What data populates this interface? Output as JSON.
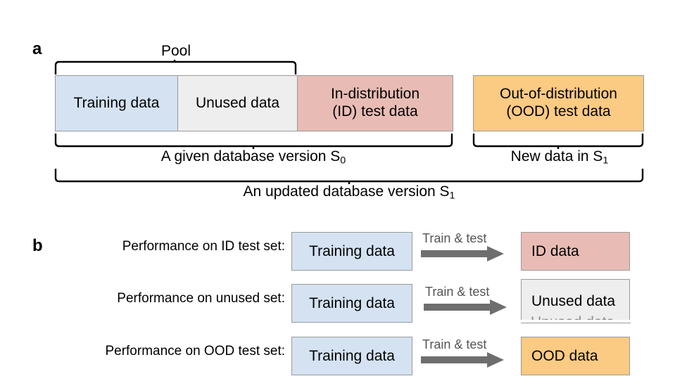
{
  "figure": {
    "panel_a": {
      "letter": "a",
      "pool_label": "Pool",
      "segments": [
        {
          "label": "Training data",
          "color": "#d4e2f2",
          "name": "training-data"
        },
        {
          "label": "Unused data",
          "color": "#eeeeee",
          "name": "unused-data"
        },
        {
          "label_line1": "In-distribution",
          "label_line2": "(ID) test data",
          "color": "#e8bcb4",
          "name": "id-test-data"
        }
      ],
      "ood_segment": {
        "label_line1": "Out-of-distribution",
        "label_line2": "(OOD) test data",
        "color": "#fbca83",
        "name": "ood-test-data"
      },
      "brackets": [
        {
          "text_prefix": "A given database version S",
          "subscript": "0",
          "name": "given-database-version"
        },
        {
          "text_prefix": "New data in S",
          "subscript": "1",
          "name": "new-data"
        },
        {
          "text_prefix": "An updated database version S",
          "subscript": "1",
          "name": "updated-database-version"
        }
      ]
    },
    "panel_b": {
      "letter": "b",
      "arrow_label": "Train & test",
      "rows": [
        {
          "label": "Performance on ID test set:",
          "source": "Training data",
          "target": "ID data",
          "target_color": "#e8bcb4",
          "name": "row-id"
        },
        {
          "label": "Performance on unused set:",
          "source": "Training data",
          "target": "Unused data",
          "target_color": "#eeeeee",
          "ghost": "Unused data",
          "name": "row-unused"
        },
        {
          "label": "Performance on OOD test set:",
          "source": "Training data",
          "target": "OOD data",
          "target_color": "#fbca83",
          "name": "row-ood"
        }
      ]
    }
  }
}
